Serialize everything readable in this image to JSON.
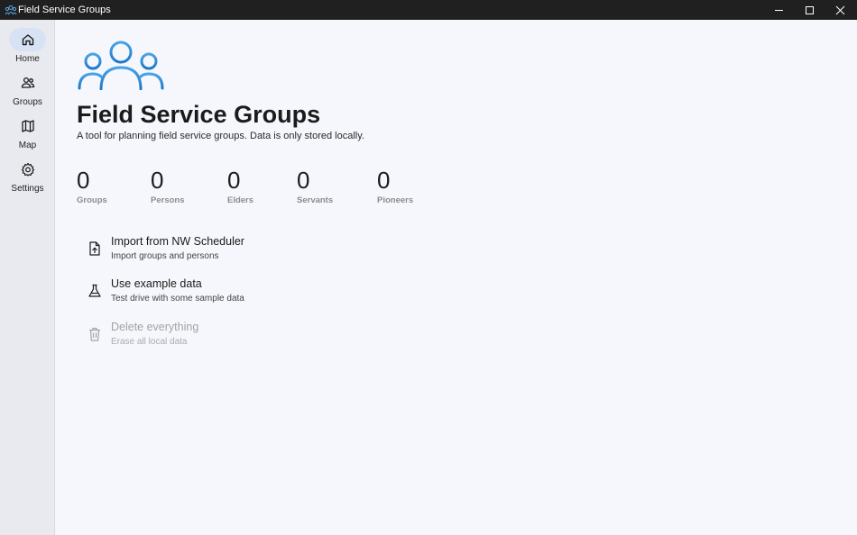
{
  "window": {
    "title": "Field Service Groups",
    "app_icon": "people-icon",
    "controls": [
      "minimize-icon",
      "maximize-icon",
      "close-icon"
    ]
  },
  "sidebar": {
    "items": [
      {
        "label": "Home",
        "icon": "home-icon",
        "active": true
      },
      {
        "label": "Groups",
        "icon": "people-icon",
        "active": false
      },
      {
        "label": "Map",
        "icon": "map-icon",
        "active": false
      },
      {
        "label": "Settings",
        "icon": "gear-icon",
        "active": false
      }
    ]
  },
  "main": {
    "hero_icon": "people-group-icon",
    "title": "Field Service Groups",
    "subtitle": "A tool for planning field service groups. Data is only stored locally.",
    "stats": [
      {
        "value": "0",
        "label": "Groups"
      },
      {
        "value": "0",
        "label": "Persons"
      },
      {
        "value": "0",
        "label": "Elders"
      },
      {
        "value": "0",
        "label": "Servants"
      },
      {
        "value": "0",
        "label": "Pioneers"
      }
    ],
    "actions": [
      {
        "title": "Import from NW Scheduler",
        "subtitle": "Import groups and persons",
        "icon": "file-upload-icon",
        "enabled": true
      },
      {
        "title": "Use example data",
        "subtitle": "Test drive with some sample data",
        "icon": "flask-icon",
        "enabled": true
      },
      {
        "title": "Delete everything",
        "subtitle": "Erase all local data",
        "icon": "trash-icon",
        "enabled": false
      }
    ]
  },
  "colors": {
    "accent": "#2b87d3",
    "titlebar": "#202020",
    "sidebar": "#e9eaf0",
    "active_pill": "#d7e3f4",
    "background": "#f6f7fc"
  }
}
